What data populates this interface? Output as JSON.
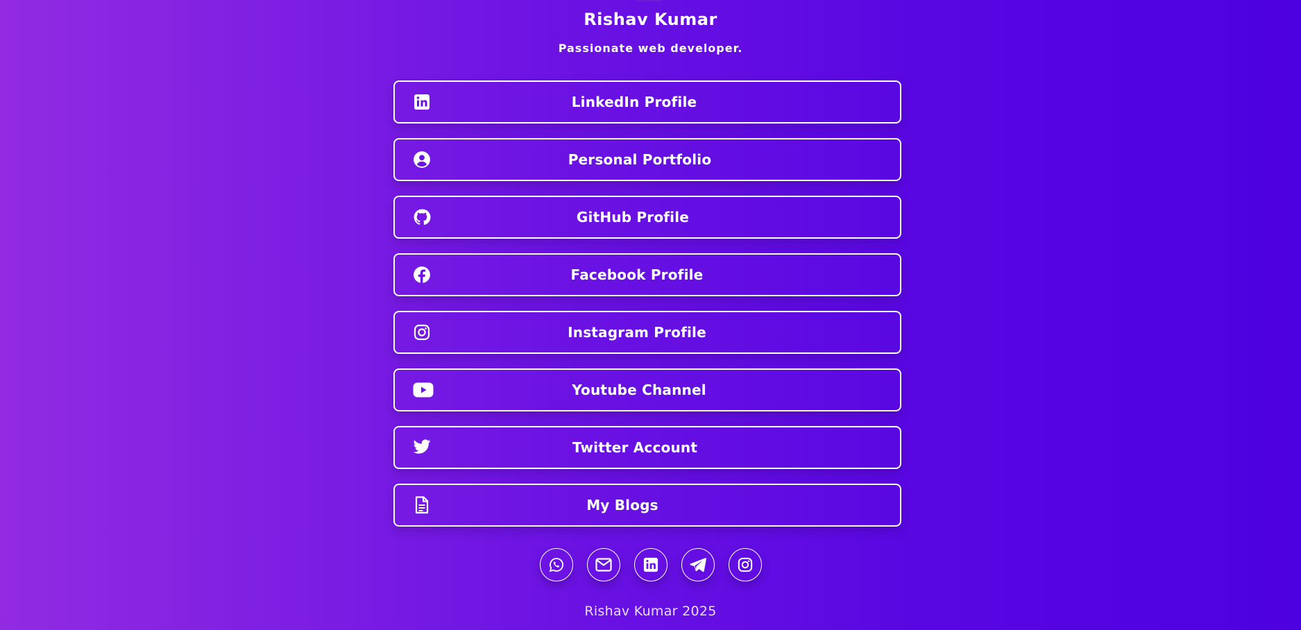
{
  "profile": {
    "name": "Rishav Kumar",
    "tagline": "Passionate web developer."
  },
  "links": [
    {
      "label": "LinkedIn Profile",
      "icon": "linkedin-icon"
    },
    {
      "label": "Personal Portfolio",
      "icon": "user-circle-icon"
    },
    {
      "label": "GitHub Profile",
      "icon": "github-icon"
    },
    {
      "label": "Facebook Profile",
      "icon": "facebook-icon"
    },
    {
      "label": "Instagram Profile",
      "icon": "instagram-icon"
    },
    {
      "label": "Youtube Channel",
      "icon": "youtube-icon"
    },
    {
      "label": "Twitter Account",
      "icon": "twitter-icon"
    },
    {
      "label": "My Blogs",
      "icon": "document-icon"
    }
  ],
  "socials": [
    {
      "icon": "whatsapp-icon"
    },
    {
      "icon": "mail-icon"
    },
    {
      "icon": "linkedin-icon"
    },
    {
      "icon": "telegram-icon"
    },
    {
      "icon": "instagram-icon"
    }
  ],
  "footer": {
    "text": "Rishav Kumar 2025"
  },
  "colors": {
    "gradient_start": "#922be2",
    "gradient_end": "#4d00e0",
    "foreground": "#ffffff"
  }
}
